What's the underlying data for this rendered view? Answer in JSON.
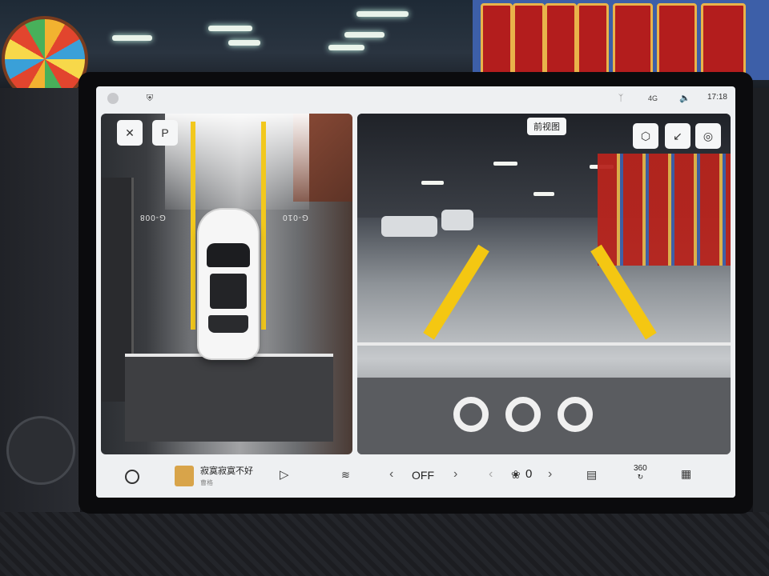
{
  "colors": {
    "lane_yellow": "#f4c712",
    "screen_bg": "#eef0f2",
    "banner_red": "#b31d1d"
  },
  "status_bar": {
    "avatar_icon": "user-avatar-icon",
    "shield_icon": "shield-icon",
    "bluetooth_icon": "bluetooth-icon",
    "signal_label": "4G",
    "volume_icon": "volume-icon",
    "time": "17:18"
  },
  "left_view": {
    "close_symbol": "✕",
    "parking_symbol": "P",
    "slot_left": "G-008",
    "slot_right": "G-010"
  },
  "right_view": {
    "title": "前视图",
    "buttons": [
      "3d-view-icon",
      "minimize-icon",
      "settings-icon"
    ]
  },
  "dock": {
    "song_title": "寂寞寂寞不好",
    "song_artist": "曹格",
    "defrost_icon": "defrost-icon",
    "climate_value": "OFF",
    "fan_value": "0",
    "seat_icon": "seat-icon",
    "view_360_label": "360",
    "apps_icon": "apps-grid-icon"
  }
}
